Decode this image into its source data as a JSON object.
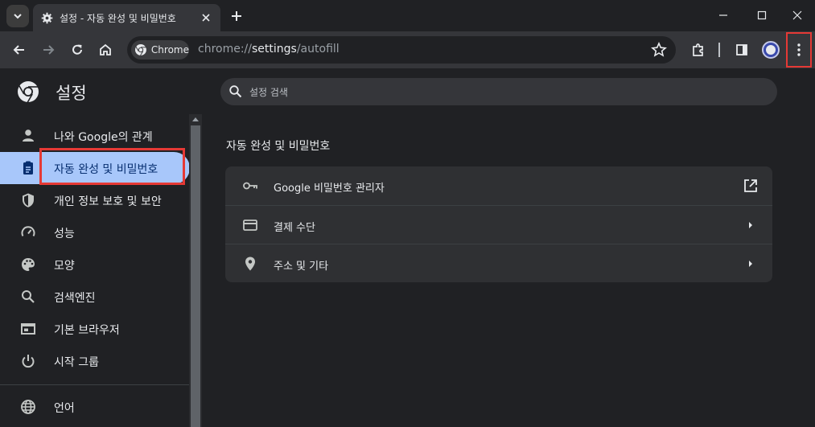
{
  "tab": {
    "title": "설정 - 자동 완성 및 비밀번호"
  },
  "omnibox": {
    "chip_label": "Chrome",
    "url_scheme": "chrome://",
    "url_host": "settings",
    "url_path": "/autofill"
  },
  "settings": {
    "title": "설정",
    "search_placeholder": "설정 검색",
    "nav": [
      {
        "label": "나와 Google의 관계",
        "icon": "person-icon"
      },
      {
        "label": "자동 완성 및 비밀번호",
        "icon": "clipboard-icon",
        "active": true
      },
      {
        "label": "개인 정보 보호 및 보안",
        "icon": "shield-icon"
      },
      {
        "label": "성능",
        "icon": "speedometer-icon"
      },
      {
        "label": "모양",
        "icon": "palette-icon"
      },
      {
        "label": "검색엔진",
        "icon": "search-icon"
      },
      {
        "label": "기본 브라우저",
        "icon": "browser-icon"
      },
      {
        "label": "시작 그룹",
        "icon": "power-icon"
      },
      {
        "label": "언어",
        "icon": "globe-icon"
      }
    ],
    "section_title": "자동 완성 및 비밀번호",
    "rows": [
      {
        "label": "Google 비밀번호 관리자",
        "icon": "key-icon",
        "end_icon": "open-external-icon"
      },
      {
        "label": "결제 수단",
        "icon": "credit-card-icon",
        "end_icon": "chevron-right-icon"
      },
      {
        "label": "주소 및 기타",
        "icon": "location-pin-icon",
        "end_icon": "chevron-right-icon"
      }
    ]
  },
  "colors": {
    "active_nav": "#a8c7fa",
    "highlight_border": "#e53935",
    "background": "#202124"
  }
}
